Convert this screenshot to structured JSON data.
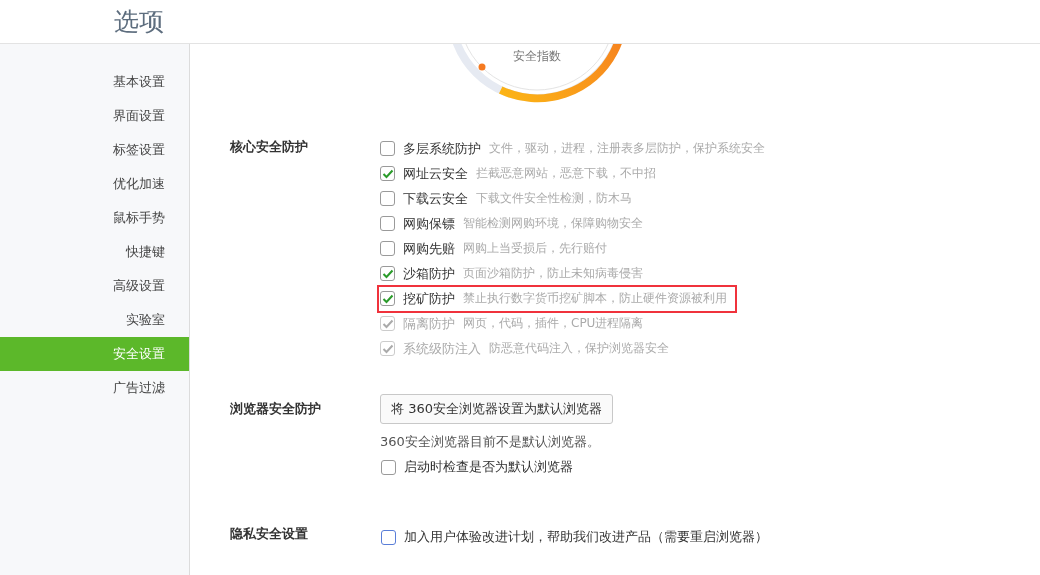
{
  "window": {
    "title": "选项"
  },
  "sidebar": {
    "items": [
      {
        "label": "基本设置",
        "selected": false
      },
      {
        "label": "界面设置",
        "selected": false
      },
      {
        "label": "标签设置",
        "selected": false
      },
      {
        "label": "优化加速",
        "selected": false
      },
      {
        "label": "鼠标手势",
        "selected": false
      },
      {
        "label": "快捷键",
        "selected": false
      },
      {
        "label": "高级设置",
        "selected": false
      },
      {
        "label": "实验室",
        "selected": false
      },
      {
        "label": "安全设置",
        "selected": true
      },
      {
        "label": "广告过滤",
        "selected": false
      }
    ]
  },
  "gauge": {
    "label": "安全指数"
  },
  "core_protection": {
    "title": "核心安全防护",
    "options": [
      {
        "label": "多层系统防护",
        "description": "文件，驱动，进程，注册表多层防护，保护系统安全",
        "checked": false,
        "disabled": false,
        "highlighted": false
      },
      {
        "label": "网址云安全",
        "description": "拦截恶意网站，恶意下载，不中招",
        "checked": true,
        "disabled": false,
        "highlighted": false
      },
      {
        "label": "下载云安全",
        "description": "下载文件安全性检测，防木马",
        "checked": false,
        "disabled": false,
        "highlighted": false
      },
      {
        "label": "网购保镖",
        "description": "智能检测网购环境，保障购物安全",
        "checked": false,
        "disabled": false,
        "highlighted": false
      },
      {
        "label": "网购先赔",
        "description": "网购上当受损后，先行赔付",
        "checked": false,
        "disabled": false,
        "highlighted": false
      },
      {
        "label": "沙箱防护",
        "description": "页面沙箱防护，防止未知病毒侵害",
        "checked": true,
        "disabled": false,
        "highlighted": false
      },
      {
        "label": "挖矿防护",
        "description": "禁止执行数字货币挖矿脚本，防止硬件资源被利用",
        "checked": true,
        "disabled": false,
        "highlighted": true
      },
      {
        "label": "隔离防护",
        "description": "网页，代码，插件，CPU进程隔离",
        "checked": true,
        "disabled": true,
        "highlighted": false
      },
      {
        "label": "系统级防注入",
        "description": "防恶意代码注入，保护浏览器安全",
        "checked": true,
        "disabled": true,
        "highlighted": false
      }
    ]
  },
  "browser_protection": {
    "title": "浏览器安全防护",
    "button": "将 360安全浏览器设置为默认浏览器",
    "note": "360安全浏览器目前不是默认浏览器。",
    "options": [
      {
        "label": "启动时检查是否为默认浏览器",
        "checked": false
      }
    ]
  },
  "privacy": {
    "title": "隐私安全设置",
    "options": [
      {
        "label": "加入用户体验改进计划，帮助我们改进产品（需要重启浏览器）",
        "checked": false
      }
    ]
  }
}
